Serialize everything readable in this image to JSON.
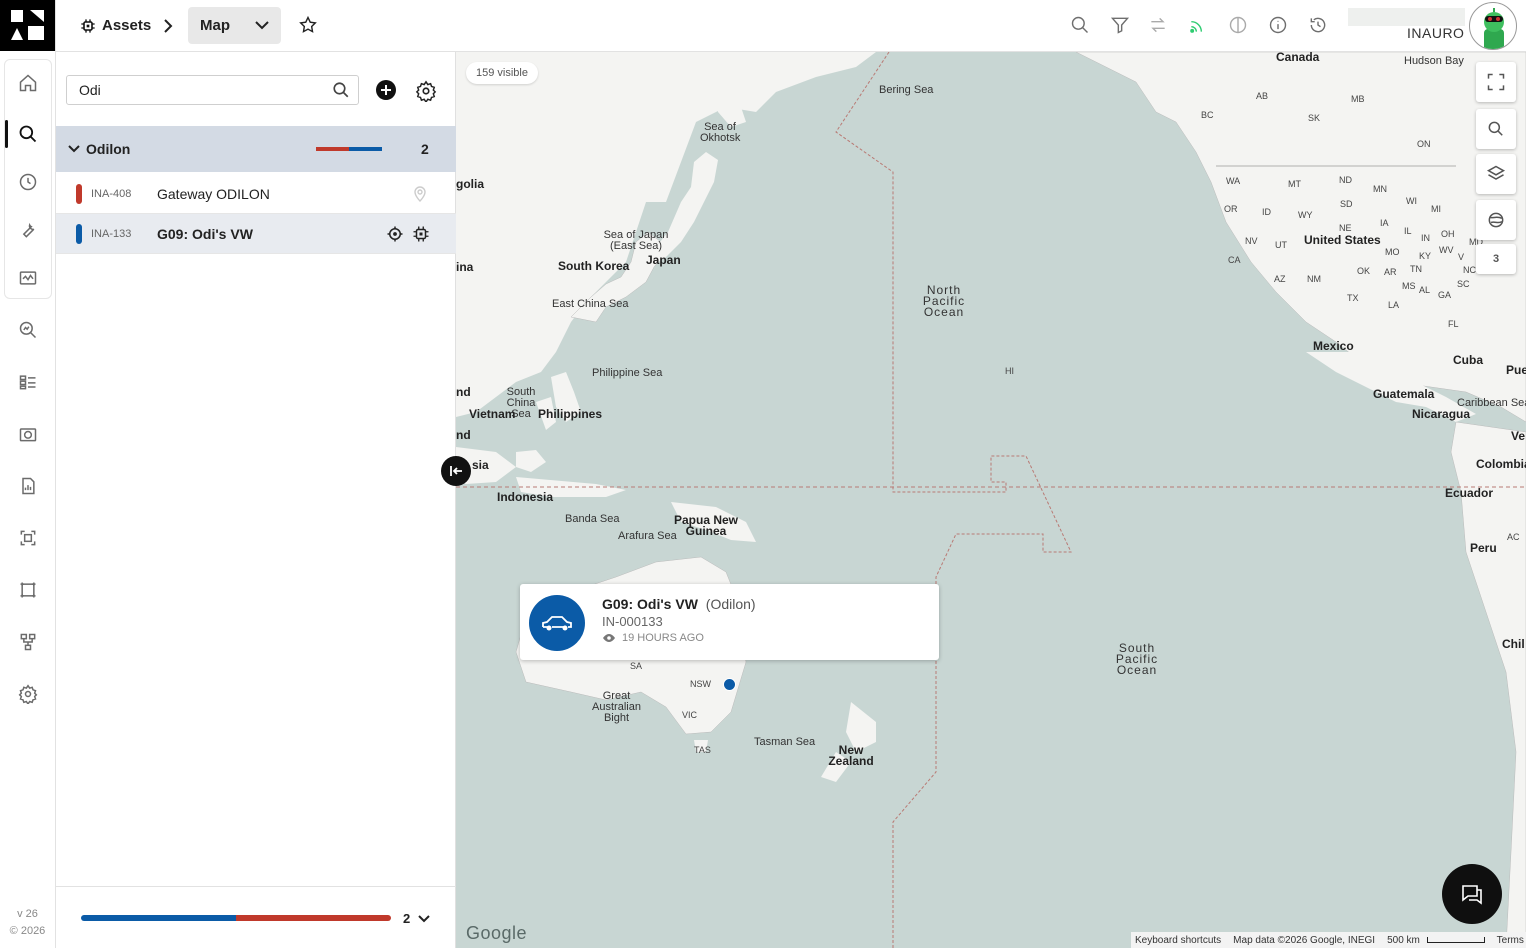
{
  "app": {
    "version": "v 26",
    "copyright": "© 2026",
    "org": "INAURO"
  },
  "breadcrumb": {
    "section": "Assets",
    "view": "Map"
  },
  "rail": {
    "items": [
      "home-icon",
      "search-icon",
      "history-icon",
      "wrench-icon",
      "monitor-icon",
      "analytics-icon",
      "dashboard-icon",
      "camera-icon",
      "report-icon",
      "scan-icon",
      "geofence-icon",
      "hierarchy-icon",
      "settings-icon"
    ],
    "active": "search-icon"
  },
  "toolbar": {
    "icons": [
      "search-icon",
      "filter-icon",
      "swap-icon",
      "signal-icon",
      "contrast-icon",
      "info-icon",
      "history-icon"
    ],
    "signal_color": "#2ecc71"
  },
  "panel": {
    "search_value": "Odi",
    "group": {
      "name": "Odilon",
      "count": "2",
      "bar_colors": [
        "#c0392b",
        "#0b5ba7"
      ]
    },
    "rows": [
      {
        "id": "INA-408",
        "name": "Gateway ODILON",
        "color": "#c0392b"
      },
      {
        "id": "INA-133",
        "name": "G09: Odi's VW",
        "color": "#0b5ba7"
      }
    ],
    "footer_count": "2"
  },
  "map": {
    "visible_badge": "159 visible",
    "layer_count": "3",
    "labels": {
      "canada": "Canada",
      "hudson_bay": "Hudson Bay",
      "bering_sea": "Bering Sea",
      "sea_of_okhotsk": "Sea of Okhotsk",
      "golia": "golia",
      "sea_of_japan": "Sea of Japan (East Sea)",
      "china": "ina",
      "south_korea": "South Korea",
      "japan": "Japan",
      "east_china_sea": "East China Sea",
      "north_pacific": "North Pacific Ocean",
      "hi": "HI",
      "philippine_sea": "Philippine Sea",
      "south_china_sea": "South China Sea",
      "vietnam": "Vietnam",
      "philippines": "Philippines",
      "nd1": "nd",
      "nd2": "nd",
      "sia": "sia",
      "indonesia": "Indonesia",
      "banda_sea": "Banda Sea",
      "papua": "Papua New Guinea",
      "arafura": "Arafura Sea",
      "sa": "SA",
      "nsw": "NSW",
      "vic": "VIC",
      "tas": "TAS",
      "great_bight": "Great Australian Bight",
      "tasman": "Tasman Sea",
      "nz": "New Zealand",
      "south_pacific": "South Pacific Ocean",
      "ab": "AB",
      "bc": "BC",
      "sk": "SK",
      "mb": "MB",
      "on": "ON",
      "wa": "WA",
      "mt": "MT",
      "nd_us": "ND",
      "mn": "MN",
      "wi": "WI",
      "mi": "MI",
      "or": "OR",
      "id": "ID",
      "wy": "WY",
      "sd": "SD",
      "ne": "NE",
      "ia": "IA",
      "il": "IL",
      "in": "IN",
      "oh": "OH",
      "md": "MD",
      "nv": "NV",
      "ut": "UT",
      "united_states": "United States",
      "mo": "MO",
      "ky": "KY",
      "wv": "WV",
      "va": "V",
      "ca": "CA",
      "az": "AZ",
      "nm": "NM",
      "ok": "OK",
      "ar": "AR",
      "tn": "TN",
      "nc": "NC",
      "sc": "SC",
      "ms": "MS",
      "al": "AL",
      "ga": "GA",
      "tx": "TX",
      "la": "LA",
      "fl": "FL",
      "mexico": "Mexico",
      "cuba": "Cuba",
      "pue": "Pue",
      "guatemala": "Guatemala",
      "caribbean": "Caribbean Sea",
      "nicaragua": "Nicaragua",
      "ve": "Ve",
      "colombia": "Colombia",
      "ecuador": "Ecuador",
      "peru": "Peru",
      "ac": "AC",
      "chile": "Chil"
    },
    "popup": {
      "title": "G09: Odi's VW",
      "group": "(Odilon)",
      "device": "IN-000133",
      "seen": "19 HOURS AGO"
    },
    "footer": {
      "shortcuts": "Keyboard shortcuts",
      "attribution": "Map data ©2026 Google, INEGI",
      "scale": "500 km",
      "terms": "Terms"
    },
    "google": "Google",
    "colors": {
      "water": "#c8d6d3",
      "land": "#f4f4f2",
      "marker": "#0b5ba7"
    }
  }
}
